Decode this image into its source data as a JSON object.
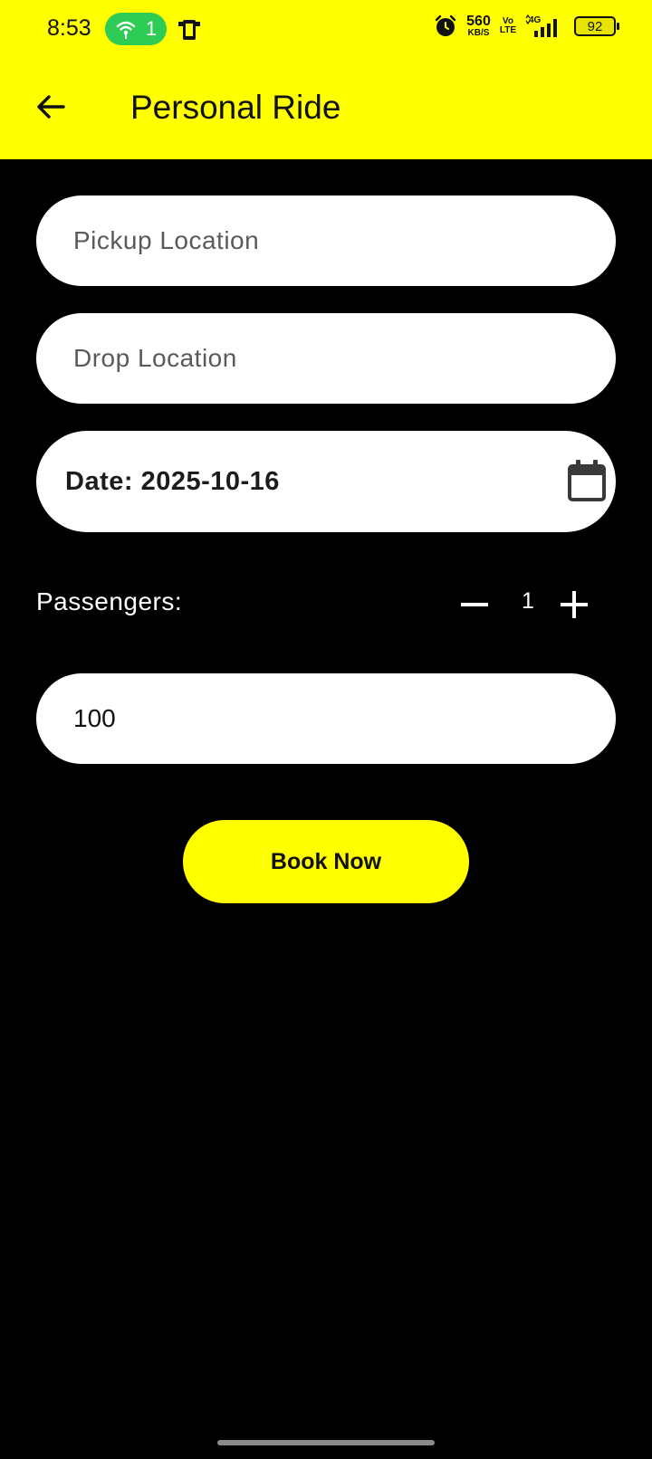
{
  "status_bar": {
    "time": "8:53",
    "hotspot_count": "1",
    "network_speed_value": "560",
    "network_speed_unit": "KB/S",
    "volte_top": "Vo",
    "volte_bottom": "LTE",
    "network_type": "4G",
    "battery_level": "92",
    "icons": [
      "hotspot-icon",
      "phone-notification-icon",
      "alarm-icon",
      "signal-icon",
      "battery-icon"
    ]
  },
  "app_bar": {
    "title": "Personal Ride",
    "back_icon": "arrow-left-icon"
  },
  "form": {
    "pickup_placeholder": "Pickup Location",
    "pickup_value": "",
    "drop_placeholder": "Drop Location",
    "drop_value": "",
    "date_label": "Date: 2025-10-16",
    "date_icon": "calendar-icon",
    "passengers_label": "Passengers:",
    "passenger_count": "1",
    "price_value": "100"
  },
  "actions": {
    "book_label": "Book Now"
  },
  "colors": {
    "accent": "#ffff00",
    "background": "#000000",
    "field_background": "#ffffff",
    "hotspot": "#2ecc55"
  }
}
